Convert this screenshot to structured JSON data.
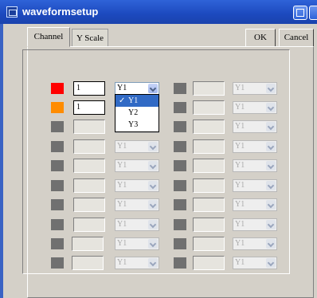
{
  "window": {
    "title": "waveformsetup"
  },
  "tabs": [
    {
      "label": "Channel"
    },
    {
      "label": "Y Scale"
    }
  ],
  "buttons": {
    "ok": "OK",
    "cancel": "Cancel"
  },
  "colors": {
    "ch1": "#ff0000",
    "ch2": "#ff8c00",
    "inactive": "#707070"
  },
  "left_rows": [
    {
      "input": "1",
      "axis": "Y1",
      "enabled": true
    },
    {
      "input": "1",
      "axis": "Y1",
      "enabled": true
    },
    {
      "input": "",
      "axis": "Y1",
      "enabled": false
    },
    {
      "input": "",
      "axis": "Y1",
      "enabled": false
    },
    {
      "input": "",
      "axis": "Y1",
      "enabled": false
    },
    {
      "input": "",
      "axis": "Y1",
      "enabled": false
    },
    {
      "input": "",
      "axis": "Y1",
      "enabled": false
    },
    {
      "input": "",
      "axis": "Y1",
      "enabled": false
    },
    {
      "input": "",
      "axis": "Y1",
      "enabled": false
    },
    {
      "input": "",
      "axis": "Y1",
      "enabled": false
    }
  ],
  "right_rows": [
    {
      "axis": "Y1"
    },
    {
      "axis": "Y1"
    },
    {
      "axis": "Y1"
    },
    {
      "axis": "Y1"
    },
    {
      "axis": "Y1"
    },
    {
      "axis": "Y1"
    },
    {
      "axis": "Y1"
    },
    {
      "axis": "Y1"
    },
    {
      "axis": "Y1"
    },
    {
      "axis": "Y1"
    }
  ],
  "dropdown": {
    "options": [
      "Y1",
      "Y2",
      "Y3"
    ],
    "selected": "Y1",
    "check": "✓"
  }
}
